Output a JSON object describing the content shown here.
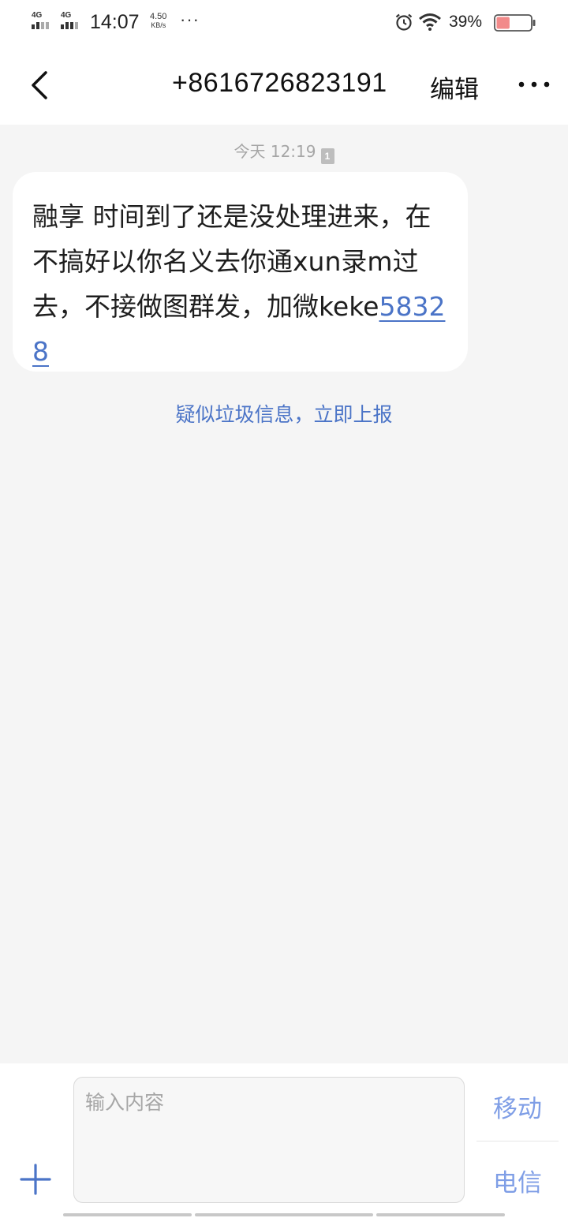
{
  "status_bar": {
    "network1": "4G",
    "network2": "4G",
    "time": "14:07",
    "speed_value": "4.50",
    "speed_unit": "KB/s",
    "more": "···",
    "battery_percent": "39%",
    "battery_level": 0.39,
    "icons": [
      "signal-icon",
      "alarm-icon",
      "wifi-icon",
      "battery-icon"
    ]
  },
  "header": {
    "back_icon": "chevron-left-icon",
    "title": "+8616726823191",
    "edit_label": "编辑",
    "more_icon": "more-dots-icon"
  },
  "conversation": {
    "timestamp": "今天 12:19",
    "sim_slot": "1",
    "message": {
      "text_before_link": "融享 时间到了还是没处理进来，在不搞好以你名义去你通xun录m过去，不接做图群发，加微keke",
      "link_text": "58328"
    },
    "spam_report": "疑似垃圾信息，立即上报"
  },
  "composer": {
    "placeholder": "输入内容",
    "value": "",
    "attach_icon": "plus-icon",
    "send_sim1_label": "移动",
    "send_sim2_label": "电信"
  },
  "colors": {
    "accent_link": "#4b74c7",
    "send_button": "#7f9ee6",
    "background": "#f5f5f5",
    "battery_low": "#f28a8a"
  }
}
